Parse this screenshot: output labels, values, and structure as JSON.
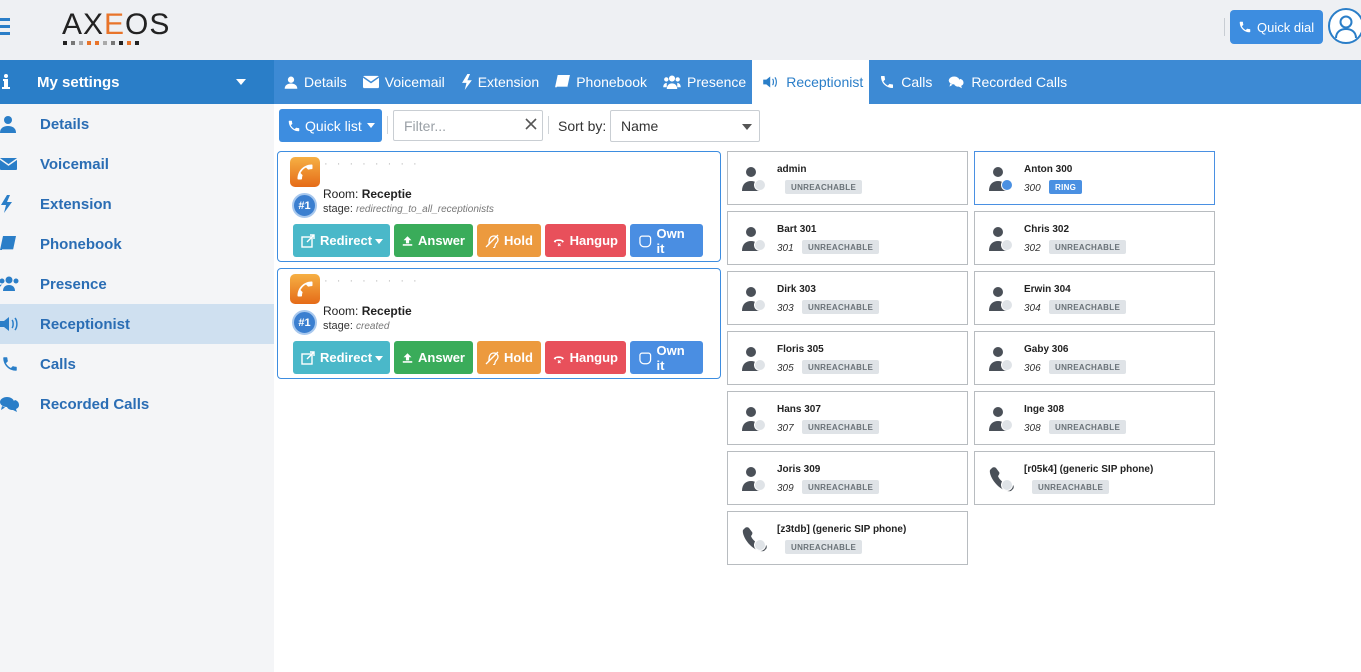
{
  "topbar": {
    "logo_text": "AXEOS",
    "quick_dial_label": "Quick dial"
  },
  "sidebar": {
    "header": "My settings",
    "items": [
      {
        "label": "Details",
        "icon": "user-icon"
      },
      {
        "label": "Voicemail",
        "icon": "envelope-icon"
      },
      {
        "label": "Extension",
        "icon": "bolt-icon"
      },
      {
        "label": "Phonebook",
        "icon": "book-icon"
      },
      {
        "label": "Presence",
        "icon": "users-icon"
      },
      {
        "label": "Receptionist",
        "icon": "volume-icon",
        "active": true
      },
      {
        "label": "Calls",
        "icon": "phone-icon"
      },
      {
        "label": "Recorded Calls",
        "icon": "comments-icon"
      }
    ]
  },
  "tabs": [
    {
      "label": "Details",
      "icon": "user-icon"
    },
    {
      "label": "Voicemail",
      "icon": "envelope-icon"
    },
    {
      "label": "Extension",
      "icon": "bolt-icon"
    },
    {
      "label": "Phonebook",
      "icon": "book-icon"
    },
    {
      "label": "Presence",
      "icon": "users-icon"
    },
    {
      "label": "Receptionist",
      "icon": "volume-icon",
      "active": true
    },
    {
      "label": "Calls",
      "icon": "phone-icon"
    },
    {
      "label": "Recorded Calls",
      "icon": "comments-icon"
    }
  ],
  "toolbar": {
    "quick_list_label": "Quick list",
    "filter_placeholder": "Filter...",
    "sort_by_label": "Sort by:",
    "sort_value": "Name"
  },
  "calls": [
    {
      "caller": "· · · · · · · ·",
      "room_label": "Room:",
      "room": "Receptie",
      "queue": "#1",
      "stage_label": "stage:",
      "stage": "redirecting_to_all_receptionists"
    },
    {
      "caller": "· · · · · · · ·",
      "room_label": "Room:",
      "room": "Receptie",
      "queue": "#1",
      "stage_label": "stage:",
      "stage": "created"
    }
  ],
  "call_actions": {
    "redirect": "Redirect",
    "answer": "Answer",
    "hold": "Hold",
    "hangup": "Hangup",
    "own_it": "Own it"
  },
  "extensions": [
    {
      "name": "admin",
      "number": "",
      "status": "UNREACHABLE",
      "type": "user"
    },
    {
      "name": "Anton 300",
      "number": "300",
      "status": "RING",
      "type": "user"
    },
    {
      "name": "Bart 301",
      "number": "301",
      "status": "UNREACHABLE",
      "type": "user"
    },
    {
      "name": "Chris 302",
      "number": "302",
      "status": "UNREACHABLE",
      "type": "user"
    },
    {
      "name": "Dirk 303",
      "number": "303",
      "status": "UNREACHABLE",
      "type": "user"
    },
    {
      "name": "Erwin 304",
      "number": "304",
      "status": "UNREACHABLE",
      "type": "user"
    },
    {
      "name": "Floris 305",
      "number": "305",
      "status": "UNREACHABLE",
      "type": "user"
    },
    {
      "name": "Gaby 306",
      "number": "306",
      "status": "UNREACHABLE",
      "type": "user"
    },
    {
      "name": "Hans 307",
      "number": "307",
      "status": "UNREACHABLE",
      "type": "user"
    },
    {
      "name": "Inge 308",
      "number": "308",
      "status": "UNREACHABLE",
      "type": "user"
    },
    {
      "name": "Joris 309",
      "number": "309",
      "status": "UNREACHABLE",
      "type": "user"
    },
    {
      "name": "[r05k4] (generic SIP phone)",
      "number": "",
      "status": "UNREACHABLE",
      "type": "phone"
    },
    {
      "name": "[z3tdb] (generic SIP phone)",
      "number": "",
      "status": "UNREACHABLE",
      "type": "phone"
    }
  ],
  "colors": {
    "accent": "#2a7ec8",
    "tabbar": "#3d8ad4",
    "redirect": "#4ab8c9",
    "answer": "#3aac5a",
    "hold": "#ec9a3e",
    "hangup": "#e8505b",
    "own_it": "#4a8ee2",
    "ring": "#4a90e2"
  }
}
